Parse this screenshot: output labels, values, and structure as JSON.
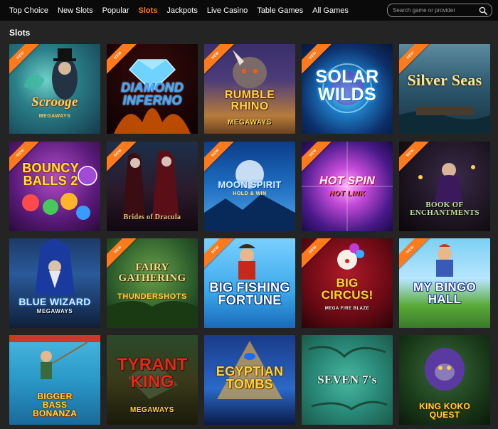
{
  "nav": {
    "items": [
      {
        "label": "Top Choice",
        "active": false
      },
      {
        "label": "New Slots",
        "active": false
      },
      {
        "label": "Popular",
        "active": false
      },
      {
        "label": "Slots",
        "active": true
      },
      {
        "label": "Jackpots",
        "active": false
      },
      {
        "label": "Live Casino",
        "active": false
      },
      {
        "label": "Table Games",
        "active": false
      },
      {
        "label": "All Games",
        "active": false
      }
    ],
    "accent_color": "#ff7a1a"
  },
  "search": {
    "placeholder": "Search game or provider",
    "icon": "magnifier-icon"
  },
  "section": {
    "title": "Slots"
  },
  "badge_text": "NEW",
  "games": [
    {
      "id": "scrooge-megaways",
      "title": "Scrooge",
      "subtitle": "MEGAWAYS",
      "new": true
    },
    {
      "id": "diamond-inferno",
      "title": "DIAMOND INFERNO",
      "subtitle": "",
      "new": true
    },
    {
      "id": "rumble-rhino",
      "title": "RUMBLE RHINO",
      "subtitle": "MEGAWAYS",
      "new": true
    },
    {
      "id": "solar-wilds",
      "title": "SOLAR WILDS",
      "subtitle": "",
      "new": true
    },
    {
      "id": "silver-seas",
      "title": "Silver Seas",
      "subtitle": "",
      "new": true
    },
    {
      "id": "bouncy-balls-2",
      "title": "BOUNCY BALLS 2",
      "subtitle": "",
      "new": true
    },
    {
      "id": "brides-of-dracula",
      "title": "Brides of Dracula",
      "subtitle": "",
      "new": true
    },
    {
      "id": "moon-spirit",
      "title": "MOON SPIRIT",
      "subtitle": "HOLD & WIN",
      "new": true
    },
    {
      "id": "hot-spin",
      "title": "HOT SPIN",
      "subtitle": "HOT LINK",
      "new": true
    },
    {
      "id": "book-of-enchantments",
      "title": "BOOK OF ENCHANTMENTS",
      "subtitle": "",
      "new": true
    },
    {
      "id": "blue-wizard",
      "title": "BLUE WIZARD",
      "subtitle": "MEGAWAYS",
      "new": false
    },
    {
      "id": "fairy-gathering",
      "title": "FAIRY GATHERING",
      "subtitle": "THUNDERSHOTS",
      "new": true
    },
    {
      "id": "big-fishing-fortune",
      "title": "BIG FISHING FORTUNE",
      "subtitle": "",
      "new": true
    },
    {
      "id": "big-circus",
      "title": "BIG CIRCUS!",
      "subtitle": "MEGA FIRE BLAZE",
      "new": true
    },
    {
      "id": "my-bingo-hall",
      "title": "MY BINGO HALL",
      "subtitle": "",
      "new": true
    },
    {
      "id": "bigger-bass-bonanza",
      "title": "BIGGER BASS BONANZA",
      "subtitle": "",
      "new": false
    },
    {
      "id": "tyrant-king",
      "title": "TYRANT KING",
      "subtitle": "MEGAWAYS",
      "new": false
    },
    {
      "id": "egyptian-tombs",
      "title": "EGYPTIAN TOMBS",
      "subtitle": "",
      "new": false
    },
    {
      "id": "seven-7s",
      "title": "SEVEN 7's",
      "subtitle": "",
      "new": false
    },
    {
      "id": "king-koko-quest",
      "title": "KING KOKO QUEST",
      "subtitle": "",
      "new": false
    }
  ]
}
